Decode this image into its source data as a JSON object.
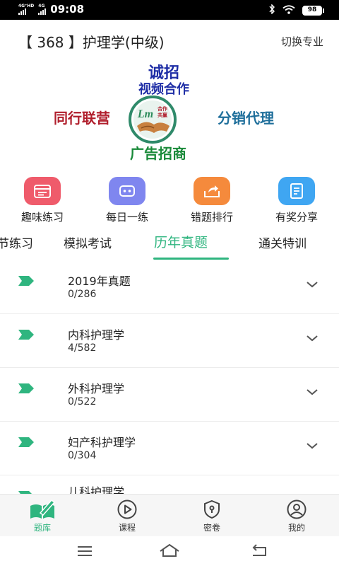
{
  "status_bar": {
    "network_1": "4G⁺HD",
    "network_2": "4G",
    "time": "09:08",
    "battery": "98"
  },
  "header": {
    "title": "【 368 】护理学(中级)",
    "switch_label": "切换专业"
  },
  "banner": {
    "line1": "诚招",
    "line2": "视频合作",
    "left": "同行联营",
    "right": "分销代理",
    "bottom": "广告招商",
    "logo_text": "Lm",
    "logo_sub1": "合作",
    "logo_sub2": "共赢"
  },
  "quick_actions": [
    {
      "label": "趣味练习",
      "color": "#ef5b6b",
      "icon": "calendar-icon"
    },
    {
      "label": "每日一练",
      "color": "#7f86ef",
      "icon": "robot-icon"
    },
    {
      "label": "错题排行",
      "color": "#f58a3c",
      "icon": "share-box-icon"
    },
    {
      "label": "有奖分享",
      "color": "#3fa6f2",
      "icon": "notebook-icon"
    }
  ],
  "tabs": [
    {
      "label": "节练习"
    },
    {
      "label": "模拟考试"
    },
    {
      "label": "历年真题"
    },
    {
      "label": "通关特训"
    }
  ],
  "list": [
    {
      "title": "2019年真题",
      "count": "0/286"
    },
    {
      "title": "内科护理学",
      "count": "4/582"
    },
    {
      "title": "外科护理学",
      "count": "0/522"
    },
    {
      "title": "妇产科护理学",
      "count": "0/304"
    },
    {
      "title": "儿科护理学",
      "count": ""
    }
  ],
  "bottom_nav": [
    {
      "label": "题库"
    },
    {
      "label": "课程"
    },
    {
      "label": "密卷"
    },
    {
      "label": "我的"
    }
  ],
  "colors": {
    "accent": "#2fb57f"
  }
}
